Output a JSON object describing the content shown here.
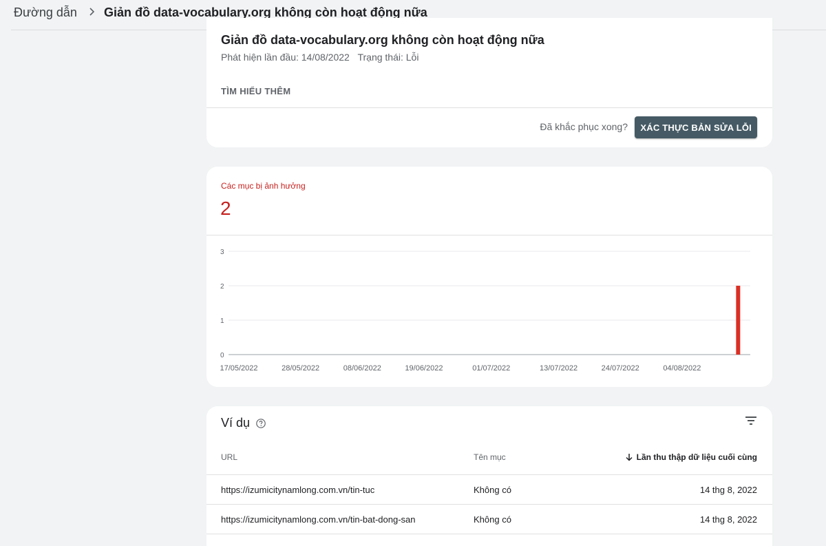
{
  "breadcrumb": {
    "root": "Đường dẫn",
    "current": "Giản đồ data-vocabulary.org không còn hoạt động nữa"
  },
  "issue": {
    "title": "Giản đồ data-vocabulary.org không còn hoạt động nữa",
    "first_detected": "Phát hiện lần đầu: 14/08/2022",
    "status": "Trạng thái: Lỗi",
    "learn_more": "TÌM HIỂU THÊM",
    "fixed_question": "Đã khắc phục xong?",
    "validate_button": "XÁC THỰC BẢN SỬA LỖI"
  },
  "summary": {
    "label": "Các mục bị ảnh hưởng",
    "value": "2",
    "accent_color": "#c5221f"
  },
  "chart_data": {
    "type": "bar",
    "title": "",
    "xlabel": "",
    "ylabel": "",
    "ylim": [
      0,
      3
    ],
    "yticks": [
      "0",
      "1",
      "2",
      "3"
    ],
    "xticks": [
      "17/05/2022",
      "28/05/2022",
      "08/06/2022",
      "19/06/2022",
      "01/07/2022",
      "13/07/2022",
      "24/07/2022",
      "04/08/2022"
    ],
    "categories": [
      "14/08/2022"
    ],
    "values": [
      2
    ],
    "bar_color": "#d93025",
    "grid": true
  },
  "examples": {
    "title": "Ví dụ",
    "columns": {
      "url": "URL",
      "name": "Tên mục",
      "last_crawled": "Lần thu thập dữ liệu cuối cùng"
    },
    "rows": [
      {
        "url": "https://izumicitynamlong.com.vn/tin-tuc",
        "name": "Không có",
        "date": "14 thg 8, 2022"
      },
      {
        "url": "https://izumicitynamlong.com.vn/tin-bat-dong-san",
        "name": "Không có",
        "date": "14 thg 8, 2022"
      }
    ]
  },
  "icons": {
    "breadcrumb_separator": "chevron-right-icon",
    "help": "help-circle-icon",
    "filter": "filter-icon",
    "sort": "arrow-down-icon"
  }
}
